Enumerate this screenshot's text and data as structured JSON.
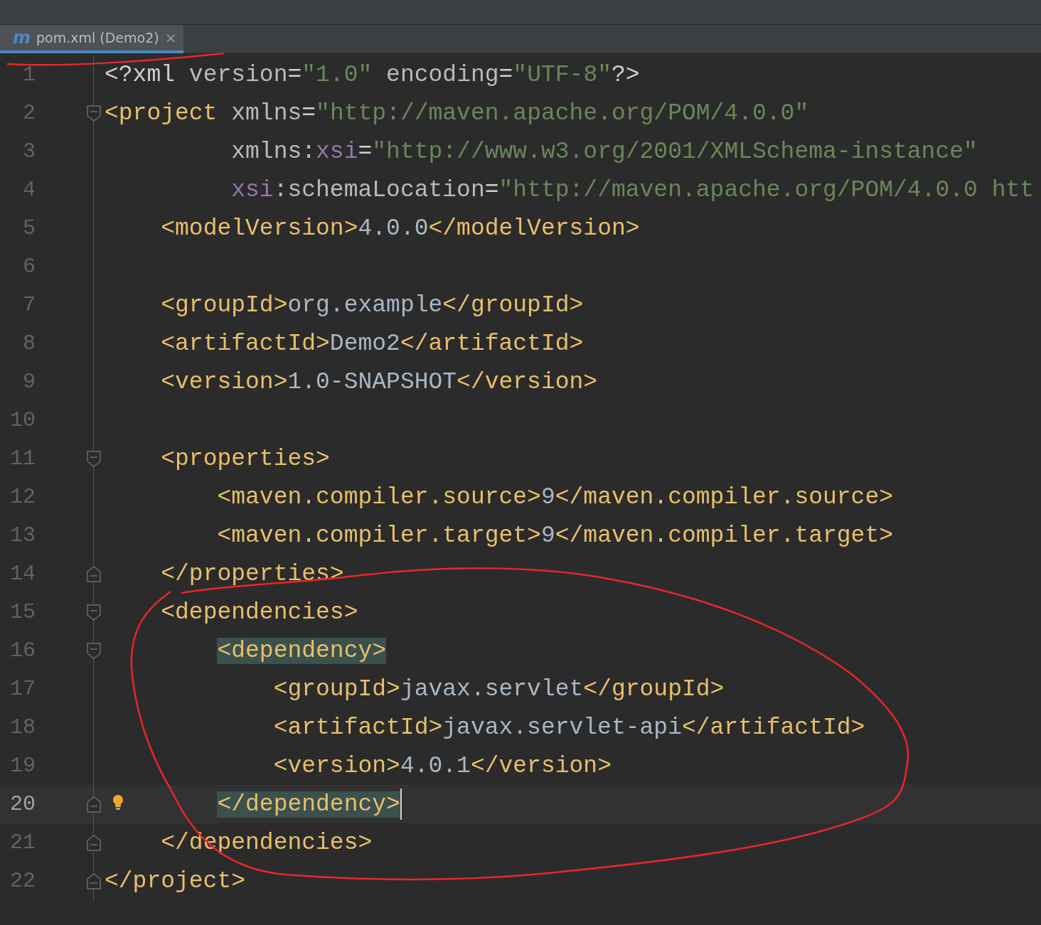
{
  "tab": {
    "icon_letter": "m",
    "label": "pom.xml (Demo2)",
    "selected": true,
    "close": "×"
  },
  "lines": [
    {
      "number": "1",
      "kind": "plain",
      "tokens": [
        {
          "kind": "punct",
          "text": "<?xml "
        },
        {
          "kind": "attr",
          "text": "version"
        },
        {
          "kind": "punct",
          "text": "="
        },
        {
          "kind": "value",
          "text": "\"1.0\""
        },
        {
          "kind": "attr",
          "text": " encoding"
        },
        {
          "kind": "punct",
          "text": "="
        },
        {
          "kind": "value",
          "text": "\"UTF-8\""
        },
        {
          "kind": "punct",
          "text": "?>"
        }
      ]
    },
    {
      "number": "2",
      "kind": "foldopen",
      "tokens": [
        {
          "kind": "tag",
          "text": "<project "
        },
        {
          "kind": "attr",
          "text": "xmlns"
        },
        {
          "kind": "punct",
          "text": "="
        },
        {
          "kind": "value",
          "text": "\"http://maven.apache.org/POM/4.0.0\""
        }
      ]
    },
    {
      "number": "3",
      "kind": "plain",
      "tokens": [
        {
          "kind": "attr",
          "text": "         xmlns:"
        },
        {
          "kind": "ns",
          "text": "xsi"
        },
        {
          "kind": "punct",
          "text": "="
        },
        {
          "kind": "value",
          "text": "\"http://www.w3.org/2001/XMLSchema-instance\""
        }
      ]
    },
    {
      "number": "4",
      "kind": "plain",
      "tokens": [
        {
          "kind": "ns",
          "text": "         xsi"
        },
        {
          "kind": "attr",
          "text": ":schemaLocation"
        },
        {
          "kind": "punct",
          "text": "="
        },
        {
          "kind": "value",
          "text": "\"http://maven.apache.org/POM/4.0.0 htt"
        }
      ]
    },
    {
      "number": "5",
      "kind": "plain",
      "tokens": [
        {
          "kind": "tag",
          "text": "    <modelVersion>"
        },
        {
          "kind": "text",
          "text": "4.0.0"
        },
        {
          "kind": "tag",
          "text": "</modelVersion>"
        }
      ]
    },
    {
      "number": "6",
      "kind": "plain"
    },
    {
      "number": "7",
      "kind": "plain",
      "tokens": [
        {
          "kind": "tag",
          "text": "    <groupId>"
        },
        {
          "kind": "text",
          "text": "org.example"
        },
        {
          "kind": "tag",
          "text": "</groupId>"
        }
      ]
    },
    {
      "number": "8",
      "kind": "plain",
      "tokens": [
        {
          "kind": "tag",
          "text": "    <artifactId>"
        },
        {
          "kind": "text",
          "text": "Demo2"
        },
        {
          "kind": "tag",
          "text": "</artifactId>"
        }
      ]
    },
    {
      "number": "9",
      "kind": "plain",
      "tokens": [
        {
          "kind": "tag",
          "text": "    <version>"
        },
        {
          "kind": "text",
          "text": "1.0-SNAPSHOT"
        },
        {
          "kind": "tag",
          "text": "</version>"
        }
      ]
    },
    {
      "number": "10",
      "kind": "plain"
    },
    {
      "number": "11",
      "kind": "foldopen",
      "tokens": [
        {
          "kind": "tag",
          "text": "    <properties>"
        }
      ]
    },
    {
      "number": "12",
      "kind": "plain",
      "tokens": [
        {
          "kind": "tag",
          "text": "        <maven.compiler.source>"
        },
        {
          "kind": "text",
          "text": "9"
        },
        {
          "kind": "tag",
          "text": "</maven.compiler.source>"
        }
      ]
    },
    {
      "number": "13",
      "kind": "plain",
      "tokens": [
        {
          "kind": "tag",
          "text": "        <maven.compiler.target>"
        },
        {
          "kind": "text",
          "text": "9"
        },
        {
          "kind": "tag",
          "text": "</maven.compiler.target>"
        }
      ]
    },
    {
      "number": "14",
      "kind": "foldclose",
      "tokens": [
        {
          "kind": "tag",
          "text": "    </properties>"
        }
      ]
    },
    {
      "number": "15",
      "kind": "foldopen",
      "tokens": [
        {
          "kind": "tag",
          "text": "    <dependencies>"
        }
      ]
    },
    {
      "number": "16",
      "kind": "foldopen",
      "tokens": [
        {
          "kind": "match",
          "text": "        <dependency>"
        }
      ]
    },
    {
      "number": "17",
      "kind": "plain",
      "tokens": [
        {
          "kind": "tag",
          "text": "            <groupId>"
        },
        {
          "kind": "text",
          "text": "javax.servlet"
        },
        {
          "kind": "tag",
          "text": "</groupId>"
        }
      ]
    },
    {
      "number": "18",
      "kind": "plain",
      "tokens": [
        {
          "kind": "tag",
          "text": "            <artifactId>"
        },
        {
          "kind": "text",
          "text": "javax.servlet-api"
        },
        {
          "kind": "tag",
          "text": "</artifactId>"
        }
      ]
    },
    {
      "number": "19",
      "kind": "plain",
      "tokens": [
        {
          "kind": "tag",
          "text": "            <version>"
        },
        {
          "kind": "text",
          "text": "4.0.1"
        },
        {
          "kind": "tag",
          "text": "</version>"
        }
      ]
    },
    {
      "number": "20",
      "kind": "foldclose",
      "current": true,
      "bulb": true,
      "tokens": [
        {
          "kind": "match",
          "text": "        </dependency>"
        }
      ]
    },
    {
      "number": "21",
      "kind": "foldclose",
      "tokens": [
        {
          "kind": "tag",
          "text": "    </dependencies>"
        }
      ]
    },
    {
      "number": "22",
      "kind": "foldclose",
      "tokens": [
        {
          "kind": "tag",
          "text": "</project>"
        }
      ]
    }
  ]
}
